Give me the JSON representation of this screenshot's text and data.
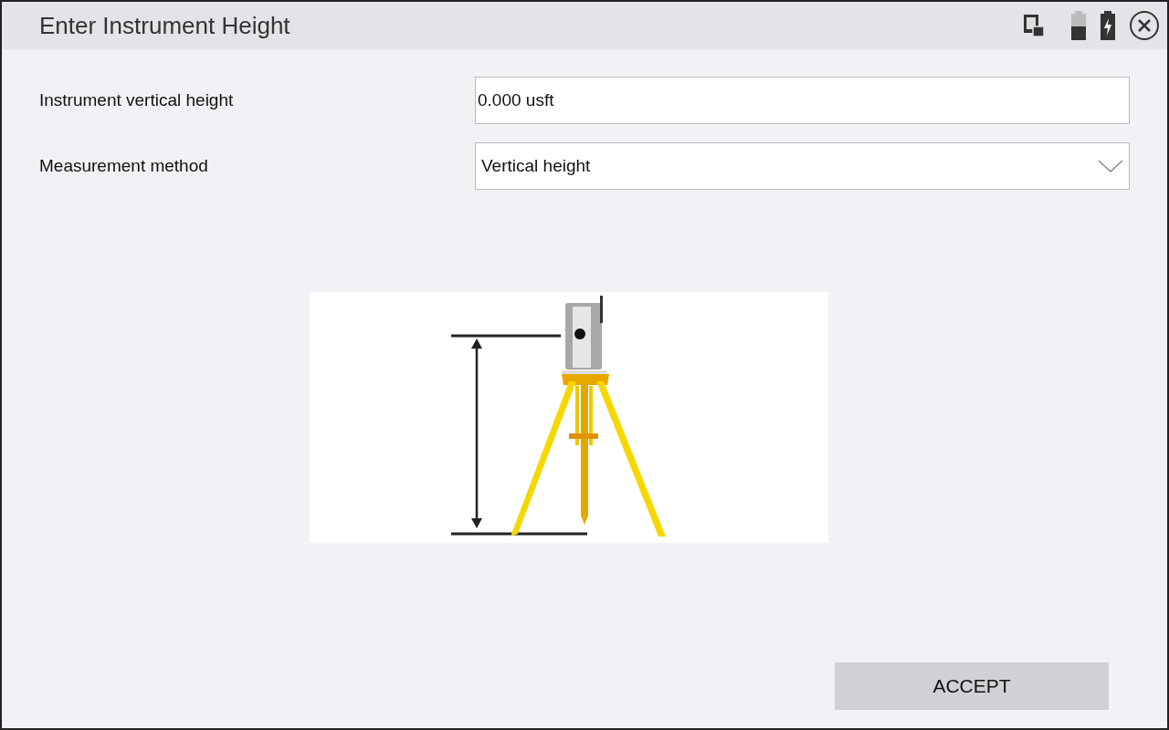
{
  "window": {
    "title": "Enter Instrument Height"
  },
  "fields": [
    {
      "kind": "text",
      "label": "Instrument vertical height",
      "value": "0.000 usft"
    },
    {
      "kind": "dropdown",
      "label": "Measurement method",
      "value": "Vertical height"
    }
  ],
  "buttons": [
    "ACCEPT"
  ]
}
